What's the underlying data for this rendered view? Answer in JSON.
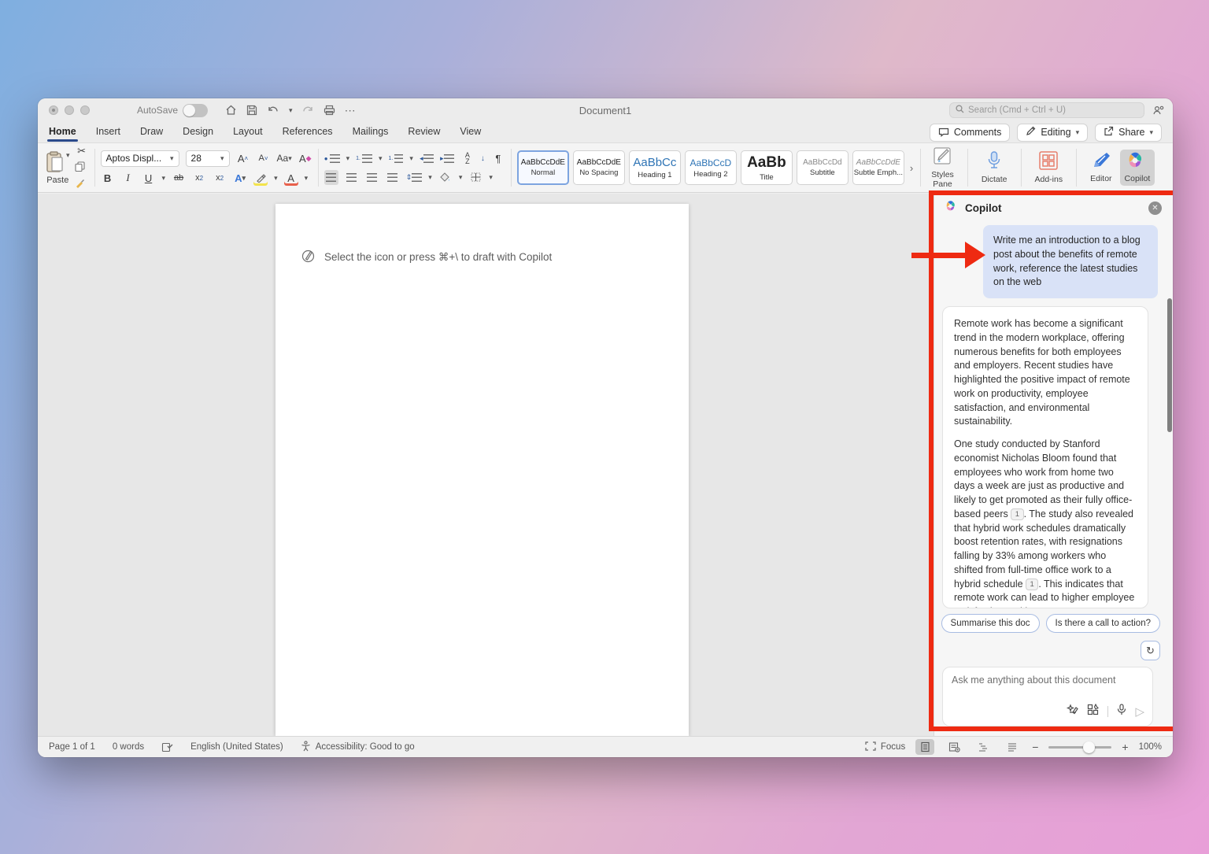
{
  "titlebar": {
    "autosave_label": "AutoSave",
    "title": "Document1",
    "search_placeholder": "Search (Cmd + Ctrl + U)"
  },
  "tabs": [
    "Home",
    "Insert",
    "Draw",
    "Design",
    "Layout",
    "References",
    "Mailings",
    "Review",
    "View"
  ],
  "top_actions": {
    "comments": "Comments",
    "editing": "Editing",
    "share": "Share"
  },
  "ribbon": {
    "paste_label": "Paste",
    "font_name": "Aptos Displ...",
    "font_size": "28",
    "bold": "B",
    "italic": "I",
    "underline": "U",
    "strike": "ab",
    "styles": [
      {
        "sample": "AaBbCcDdE",
        "label": "Normal"
      },
      {
        "sample": "AaBbCcDdE",
        "label": "No Spacing"
      },
      {
        "sample": "AaBbCc",
        "label": "Heading 1"
      },
      {
        "sample": "AaBbCcD",
        "label": "Heading 2"
      },
      {
        "sample": "AaBb",
        "label": "Title"
      },
      {
        "sample": "AaBbCcDd",
        "label": "Subtitle"
      },
      {
        "sample": "AaBbCcDdE",
        "label": "Subtle Emph..."
      }
    ],
    "styles_pane_line1": "Styles",
    "styles_pane_line2": "Pane",
    "dictate": "Dictate",
    "addins": "Add-ins",
    "editor": "Editor",
    "copilot": "Copilot"
  },
  "document": {
    "draft_hint": "Select the icon or press ⌘+\\ to draft with Copilot"
  },
  "copilot": {
    "title": "Copilot",
    "prompt": "Write me an introduction to a blog post about the benefits of remote work, reference the latest studies on the web",
    "response_p1": "Remote work has become a significant trend in the modern workplace, offering numerous benefits for both employees and employers. Recent studies have highlighted the positive impact of remote work on productivity, employee satisfaction, and environmental sustainability.",
    "response_p2a": "One study conducted by Stanford economist Nicholas Bloom found that employees who work from home two days a week are just as productive and likely to get promoted as their fully office-based peers ",
    "citation_1": "1",
    "response_p2b": ". The study also revealed that hybrid work schedules dramatically boost retention rates, with resignations falling by 33% among workers who shifted from full-time office work to a hybrid schedule ",
    "citation_2": "1",
    "response_p2c": ". This indicates that remote work can lead to higher employee satisfaction and lower turnover rates.",
    "suggestion_1": "Summarise this doc",
    "suggestion_2": "Is there a call to action?",
    "input_placeholder": "Ask me anything about this document"
  },
  "statusbar": {
    "page": "Page 1 of 1",
    "words": "0 words",
    "language": "English (United States)",
    "accessibility": "Accessibility: Good to go",
    "focus": "Focus",
    "zoom_level": "100%"
  },
  "colors": {
    "annotation_red": "#ee2a12",
    "prompt_bubble_bg": "#d9e2f7",
    "heading_blue": "#2e74b5",
    "tab_underline": "#2b4a8b",
    "suggestion_border": "#a8bce2"
  }
}
